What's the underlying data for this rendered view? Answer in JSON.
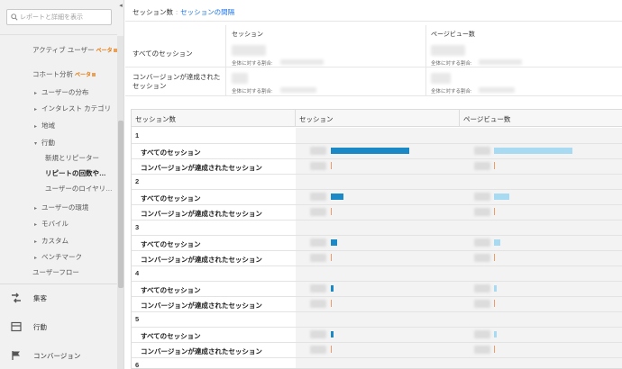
{
  "sidebar": {
    "search_placeholder": "レポートと詳細を表示",
    "beta": "ベータ",
    "items": [
      {
        "label": "アクティブ ユーザー",
        "beta": true
      },
      {
        "label": "コホート分析",
        "beta": true
      },
      {
        "label": "ユーザーの分布",
        "caret": "right"
      },
      {
        "label": "インタレスト カテゴリ",
        "caret": "right"
      },
      {
        "label": "地域",
        "caret": "right"
      },
      {
        "label": "行動",
        "caret": "down"
      },
      {
        "label": "新規とリピーター"
      },
      {
        "label": "リピートの回数や…",
        "selected": true
      },
      {
        "label": "ユーザーのロイヤリ…"
      },
      {
        "label": "ユーザーの環境",
        "caret": "right"
      },
      {
        "label": "モバイル",
        "caret": "right"
      },
      {
        "label": "カスタム",
        "caret": "right"
      },
      {
        "label": "ベンチマーク",
        "caret": "right"
      },
      {
        "label": "ユーザーフロー"
      }
    ],
    "sections": [
      {
        "label": "集客",
        "icon": "acquisition-icon"
      },
      {
        "label": "行動",
        "icon": "behavior-icon"
      },
      {
        "label": "コンバージョン",
        "icon": "flag-icon"
      }
    ]
  },
  "breadcrumb": {
    "first": "セッション数",
    "current": "セッションの間隔"
  },
  "summary": {
    "col1": "セッション",
    "col2": "ページビュー数",
    "row1": "すべてのセッション",
    "row2": "コンバージョンが達成されたセッション",
    "share_label": "全体に対する割合:"
  },
  "table": {
    "headers": [
      "セッション数",
      "セッション",
      "ページビュー数"
    ],
    "groups": [
      {
        "label": "1",
        "rows": [
          {
            "label": "すべてのセッション",
            "session_share": 1.0,
            "pv_share": 1.0
          },
          {
            "label": "コンバージョンが達成されたセッション",
            "session_share": 0,
            "pv_share": 0
          }
        ]
      },
      {
        "label": "2",
        "rows": [
          {
            "label": "すべてのセッション",
            "session_share": 0.16,
            "pv_share": 0.19
          },
          {
            "label": "コンバージョンが達成されたセッション",
            "session_share": 0,
            "pv_share": 0
          }
        ]
      },
      {
        "label": "3",
        "rows": [
          {
            "label": "すべてのセッション",
            "session_share": 0.08,
            "pv_share": 0.08
          },
          {
            "label": "コンバージョンが達成されたセッション",
            "session_share": 0,
            "pv_share": 0
          }
        ]
      },
      {
        "label": "4",
        "rows": [
          {
            "label": "すべてのセッション",
            "session_share": 0.04,
            "pv_share": 0.04
          },
          {
            "label": "コンバージョンが達成されたセッション",
            "session_share": 0,
            "pv_share": 0
          }
        ]
      },
      {
        "label": "5",
        "rows": [
          {
            "label": "すべてのセッション",
            "session_share": 0.03,
            "pv_share": 0.03
          },
          {
            "label": "コンバージョンが達成されたセッション",
            "session_share": 0,
            "pv_share": 0
          }
        ]
      },
      {
        "label": "6",
        "rows": []
      }
    ]
  },
  "colors": {
    "session_bar": "#1b89c5",
    "pageview_bar": "#a8dbf1",
    "conversion_tick": "#f09a6a",
    "beta": "#e37400"
  }
}
